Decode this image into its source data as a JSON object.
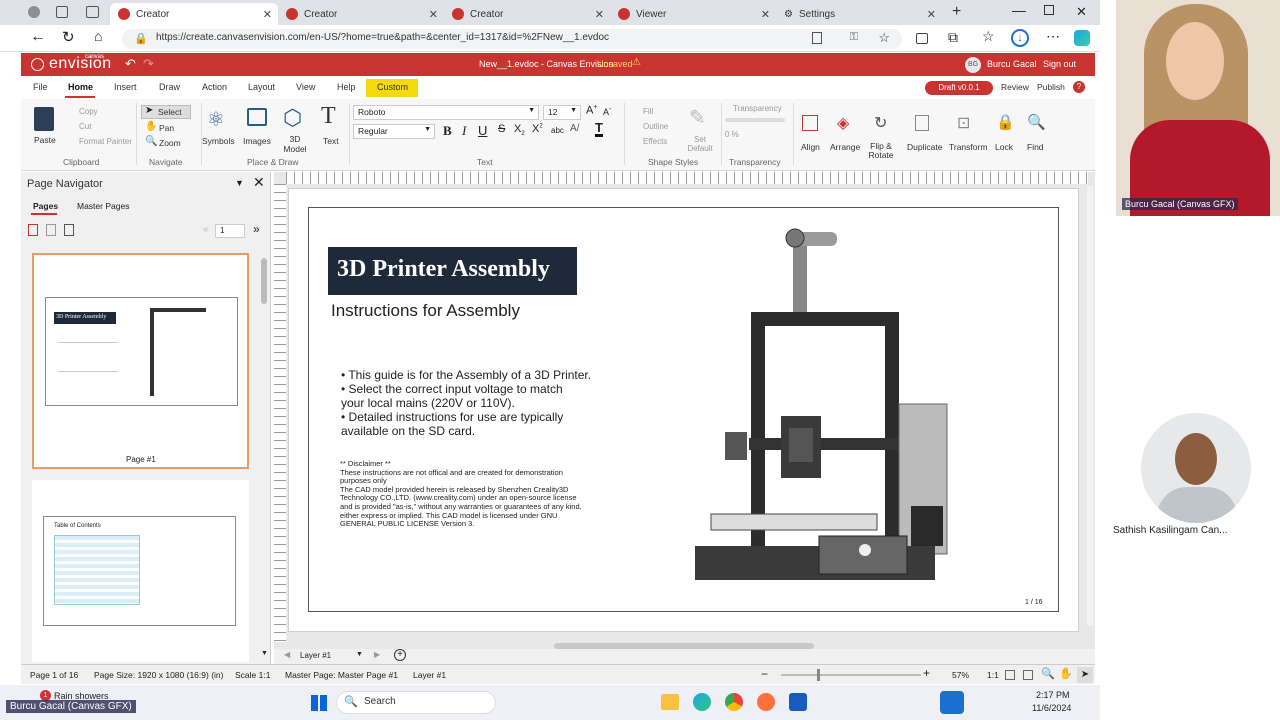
{
  "browser": {
    "tabs": [
      {
        "label": "Creator"
      },
      {
        "label": "Creator"
      },
      {
        "label": "Creator"
      },
      {
        "label": "Viewer"
      },
      {
        "label": "Settings"
      }
    ],
    "url": "https://create.canvasenvision.com/en-US/?home=true&path=&center_id=1317&id=%2FNew__1.evdoc"
  },
  "app": {
    "logo": "envision",
    "logo_small": "canvas",
    "doc_title": "New__1.evdoc - Canvas Envision",
    "unsaved": "Unsaved",
    "user_initials": "BG",
    "user_name": "Burcu Gacal",
    "signout": "Sign out",
    "draft": "Draft v0.0.1",
    "review": "Review",
    "publish": "Publish"
  },
  "ribbon_tabs": [
    "File",
    "Home",
    "Insert",
    "Draw",
    "Action",
    "Layout",
    "View",
    "Help",
    "Custom"
  ],
  "ribbon": {
    "paste": "Paste",
    "copy": "Copy",
    "cut": "Cut",
    "format_painter": "Format Painter",
    "clipboard": "Clipboard",
    "select": "Select",
    "pan": "Pan",
    "zoom": "Zoom",
    "navigate": "Navigate",
    "symbols": "Symbols",
    "images": "Images",
    "model3d": "3D Model",
    "text": "Text",
    "place_draw": "Place & Draw",
    "font": "Roboto",
    "font_style": "Regular",
    "font_size": "12",
    "text_group": "Text",
    "fill": "Fill",
    "outline": "Outline",
    "effects": "Effects",
    "set_default": "Set Default",
    "shape_styles": "Shape Styles",
    "transparency": "Transparency",
    "transparency_value": "0 %",
    "align": "Align",
    "arrange": "Arrange",
    "flip_rotate": "Flip & Rotate",
    "duplicate": "Duplicate",
    "transform": "Transform",
    "lock": "Lock",
    "find": "Find"
  },
  "navigator": {
    "title": "Page Navigator",
    "tab_pages": "Pages",
    "tab_master": "Master Pages",
    "page_input": "1",
    "page1_label": "Page #1",
    "toc_title": "Table of Contents"
  },
  "document": {
    "title": "3D Printer Assembly",
    "subtitle": "Instructions for Assembly",
    "bullets": [
      "• This guide is for the Assembly of a 3D Printer.",
      "• Select the correct input voltage to match",
      "your local mains (220V or 110V).",
      "• Detailed instructions for use are typically",
      "available on the SD card."
    ],
    "disclaimer_lines": [
      "** Disclaimer **",
      "These instructions are not offical and are created for demonstration",
      "purposes only",
      "The CAD model provided herein is released by Shenzhen Creality3D",
      "Technology CO.,LTD. (www.creality.com) under an open-source license",
      "and is provided \"as-is,\" without any warranties or guarantees of any kind,",
      "either express or implied. This CAD model is licensed under GNU",
      "GENERAL PUBLIC LICENSE Version 3."
    ],
    "page_number": "1 / 16"
  },
  "layer_bar": {
    "layer": "Layer #1"
  },
  "status": {
    "page": "Page 1 of 16",
    "page_size": "Page Size: 1920 x 1080 (16:9) (in)",
    "scale": "Scale 1:1",
    "master": "Master Page: Master Page #1",
    "layer": "Layer #1",
    "zoom": "57%",
    "ratio": "1:1"
  },
  "taskbar": {
    "weather": "Rain showers",
    "weather_badge": "1",
    "search": "Search",
    "time": "2:17 PM",
    "date": "11/6/2024"
  },
  "video": {
    "person1": "Burcu Gacal (Canvas GFX)",
    "person2": "Sathish  Kasilingam Can...",
    "overlay_bottom": "Burcu Gacal (Canvas GFX)"
  },
  "colors": {
    "brand_red": "#c8342f",
    "accent_yellow": "#f5d90a",
    "title_bg": "#1e2a3a"
  }
}
